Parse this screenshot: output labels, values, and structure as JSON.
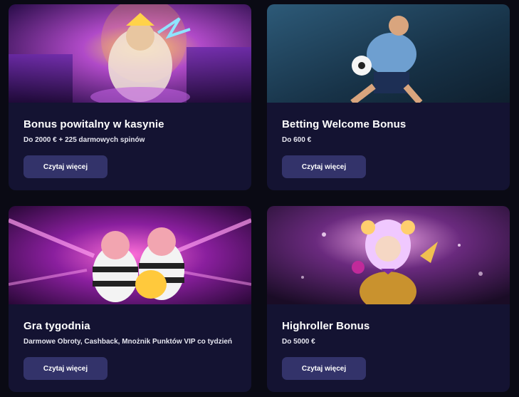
{
  "cards": [
    {
      "image": "zeus-casino-hero",
      "title": "Bonus powitalny w kasynie",
      "subtitle": "Do 2000 € + 225 darmowych spinów",
      "button": "Czytaj więcej"
    },
    {
      "image": "football-player-hero",
      "title": "Betting Welcome Bonus",
      "subtitle": "Do 600 €",
      "button": "Czytaj więcej"
    },
    {
      "image": "robber-pigs-hero",
      "title": "Gra tygodnia",
      "subtitle": "Darmowe Obroty, Cashback, Mnożnik Punktów VIP co tydzień",
      "button": "Czytaj więcej"
    },
    {
      "image": "jester-girl-hero",
      "title": "Highroller Bonus",
      "subtitle": "Do 5000 €",
      "button": "Czytaj więcej"
    }
  ],
  "colors": {
    "page_bg": "#0a0a14",
    "card_bg": "#141332",
    "button_bg": "#33336a"
  }
}
